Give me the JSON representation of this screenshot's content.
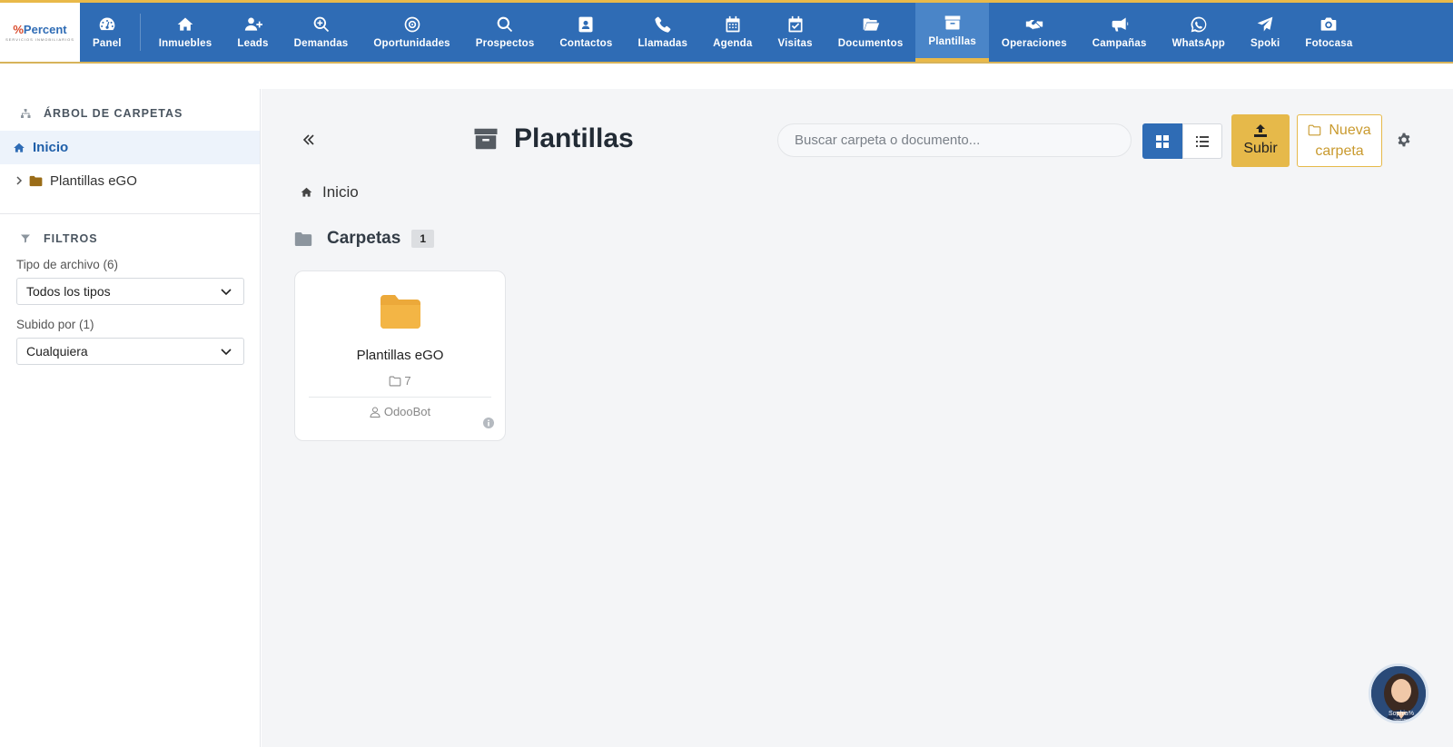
{
  "app": {
    "logo_text": "Percent",
    "logo_mark": "%",
    "logo_sub": "SERVICIOS INMOBILIARIOS"
  },
  "nav": {
    "items": [
      {
        "label": "Panel",
        "icon": "dashboard-gauge-icon"
      },
      {
        "label": "Inmuebles",
        "icon": "home-icon"
      },
      {
        "label": "Leads",
        "icon": "user-plus-icon"
      },
      {
        "label": "Demandas",
        "icon": "search-plus-icon"
      },
      {
        "label": "Oportunidades",
        "icon": "target-icon"
      },
      {
        "label": "Prospectos",
        "icon": "search-icon"
      },
      {
        "label": "Contactos",
        "icon": "address-book-icon"
      },
      {
        "label": "Llamadas",
        "icon": "phone-icon"
      },
      {
        "label": "Agenda",
        "icon": "calendar-icon"
      },
      {
        "label": "Visitas",
        "icon": "calendar-check-icon"
      },
      {
        "label": "Documentos",
        "icon": "folder-open-icon"
      },
      {
        "label": "Plantillas",
        "icon": "archive-icon",
        "active": true
      },
      {
        "label": "Operaciones",
        "icon": "handshake-icon"
      },
      {
        "label": "Campañas",
        "icon": "megaphone-icon"
      },
      {
        "label": "WhatsApp",
        "icon": "whatsapp-icon"
      },
      {
        "label": "Spoki",
        "icon": "paper-plane-icon"
      },
      {
        "label": "Fotocasa",
        "icon": "camera-icon"
      }
    ],
    "colors": {
      "bar": "#2f6cb5",
      "active": "#4a85c8",
      "accent": "#e9b949"
    }
  },
  "sidebar": {
    "tree_title": "ÁRBOL DE CARPETAS",
    "tree_home": "Inicio",
    "tree_children": [
      "Plantillas eGO"
    ],
    "filters_title": "FILTROS",
    "filters": [
      {
        "label": "Tipo de archivo (6)",
        "value": "Todos los tipos"
      },
      {
        "label": "Subido por (1)",
        "value": "Cualquiera"
      }
    ]
  },
  "main": {
    "title": "Plantillas",
    "search_placeholder": "Buscar carpeta o documento...",
    "upload_label": "Subir",
    "new_folder_line1": "Nueva",
    "new_folder_line2": "carpeta",
    "breadcrumb": "Inicio",
    "folders_heading": "Carpetas",
    "folders_count": "1",
    "folders": [
      {
        "name": "Plantillas eGO",
        "count": "7",
        "owner": "OdooBot",
        "color": "#eca93a"
      }
    ]
  },
  "assistant": {
    "name": "Sophia%",
    "sub": "%percent"
  }
}
